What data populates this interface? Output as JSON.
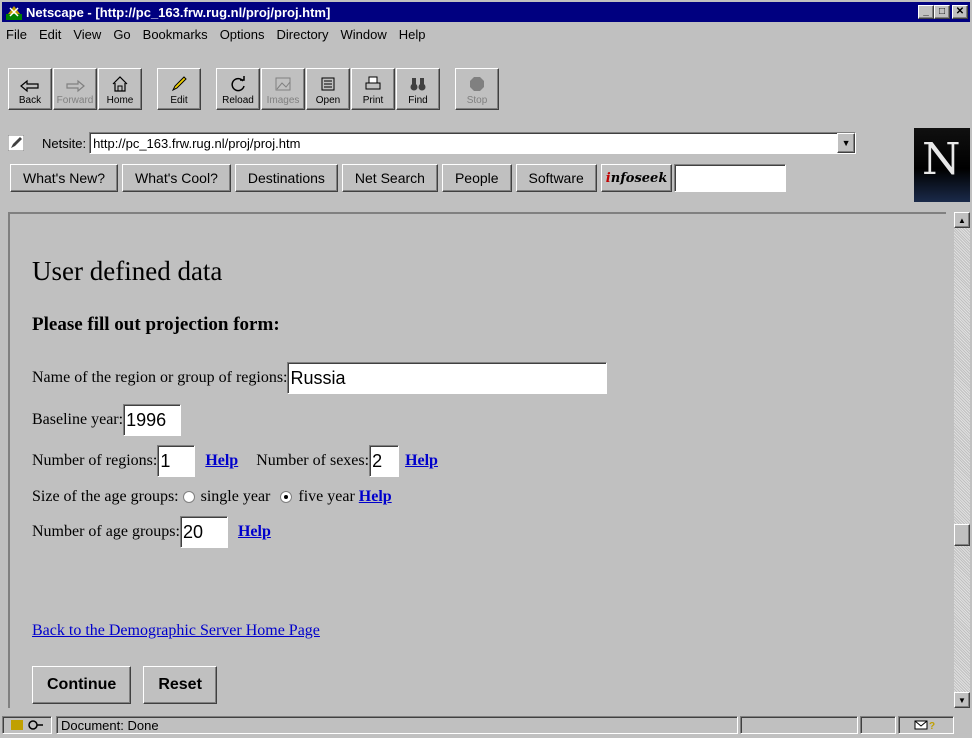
{
  "window": {
    "title": "Netscape - [http://pc_163.frw.rug.nl/proj/proj.htm]"
  },
  "menu": [
    {
      "label": "File"
    },
    {
      "label": "Edit"
    },
    {
      "label": "View"
    },
    {
      "label": "Go"
    },
    {
      "label": "Bookmarks"
    },
    {
      "label": "Options"
    },
    {
      "label": "Directory"
    },
    {
      "label": "Window"
    },
    {
      "label": "Help"
    }
  ],
  "toolbar": {
    "back": "Back",
    "forward": "Forward",
    "home": "Home",
    "edit": "Edit",
    "reload": "Reload",
    "images": "Images",
    "open": "Open",
    "print": "Print",
    "find": "Find",
    "stop": "Stop"
  },
  "location": {
    "label": "Netsite:",
    "url": "http://pc_163.frw.rug.nl/proj/proj.htm"
  },
  "directory_buttons": {
    "whats_new": "What's New?",
    "whats_cool": "What's Cool?",
    "destinations": "Destinations",
    "net_search": "Net Search",
    "people": "People",
    "software": "Software",
    "infoseek_i": "i",
    "infoseek_rest": "nfoseek"
  },
  "logo": {
    "letter": "N"
  },
  "page": {
    "heading": "User defined data",
    "subheading": "Please fill out projection form:",
    "region_label": "Name of the region or group of regions:",
    "region_value": "Russia",
    "baseline_label": "Baseline year:",
    "baseline_value": "1996",
    "regions_label": "Number of regions:",
    "regions_value": "1",
    "help_label": "Help",
    "sexes_label": "Number of sexes:",
    "sexes_value": "2",
    "age_size_label": "Size of the age groups:",
    "single_year": "single year",
    "five_year": "five year",
    "age_groups_label": "Number of age groups:",
    "age_groups_value": "20",
    "back_link": "Back to the Demographic Server Home Page",
    "continue_btn": "Continue",
    "reset_btn": "Reset"
  },
  "status": {
    "text": "Document: Done"
  },
  "colors": {
    "titlebar": "#000080",
    "link": "#0000cc",
    "chrome": "#c0c0c0"
  }
}
